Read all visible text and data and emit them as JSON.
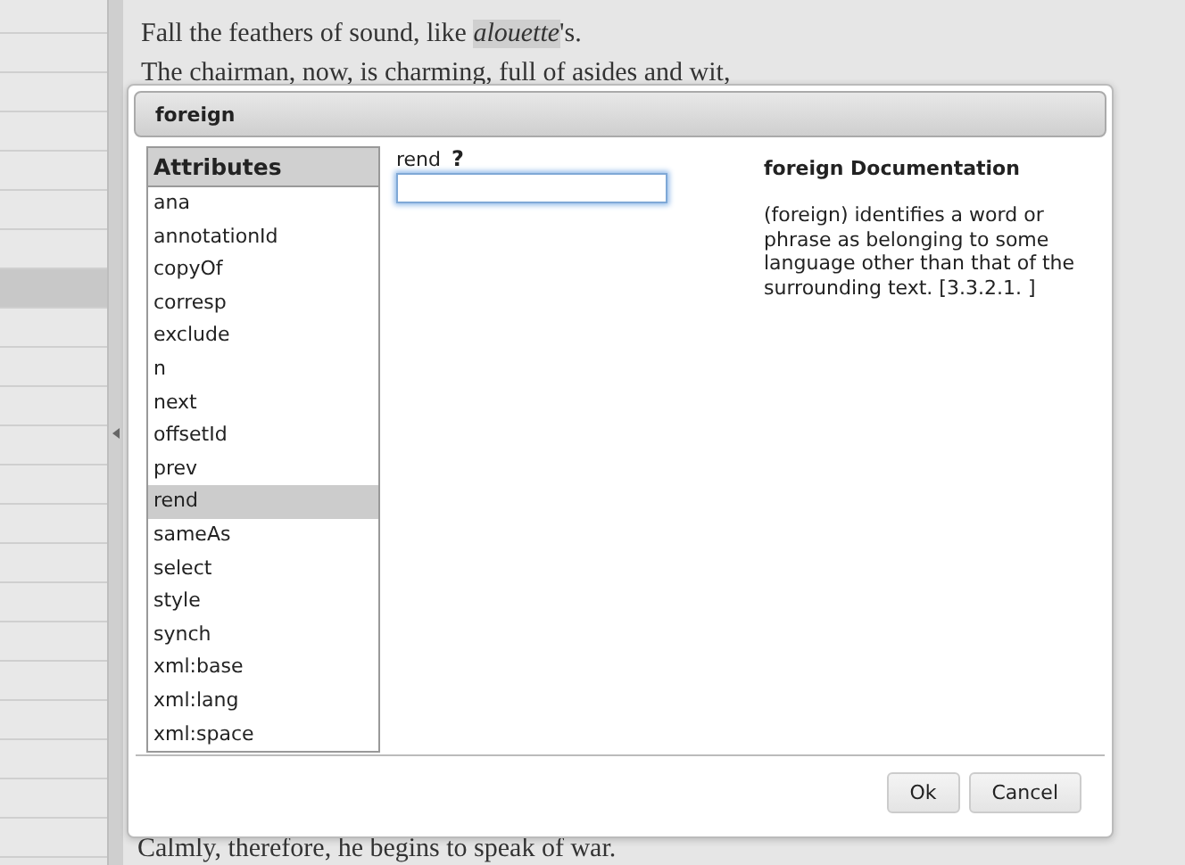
{
  "sidebar": {
    "rows": [
      {
        "selected": false
      },
      {
        "selected": false
      },
      {
        "selected": false
      },
      {
        "selected": false
      },
      {
        "selected": false
      },
      {
        "selected": false
      },
      {
        "selected": false
      },
      {
        "selected": true
      },
      {
        "selected": false
      },
      {
        "selected": false
      },
      {
        "selected": false
      },
      {
        "selected": false
      },
      {
        "selected": false
      },
      {
        "selected": false
      },
      {
        "selected": false
      },
      {
        "selected": false
      },
      {
        "selected": false
      },
      {
        "selected": false
      },
      {
        "selected": false
      },
      {
        "selected": false
      },
      {
        "selected": false
      },
      {
        "selected": false
      }
    ]
  },
  "document": {
    "lines": [
      "Fall the feathers of sound, like *alouette*'s.",
      "The chairman, now, is charming, full of asides and wit,"
    ],
    "bottom_line": "Calmly, therefore, he begins to speak of war."
  },
  "dialog": {
    "title": "foreign",
    "attributes": {
      "heading": "Attributes",
      "items": [
        {
          "label": "ana",
          "selected": false
        },
        {
          "label": "annotationId",
          "selected": false
        },
        {
          "label": "copyOf",
          "selected": false
        },
        {
          "label": "corresp",
          "selected": false
        },
        {
          "label": "exclude",
          "selected": false
        },
        {
          "label": "n",
          "selected": false
        },
        {
          "label": "next",
          "selected": false
        },
        {
          "label": "offsetId",
          "selected": false
        },
        {
          "label": "prev",
          "selected": false
        },
        {
          "label": "rend",
          "selected": true
        },
        {
          "label": "sameAs",
          "selected": false
        },
        {
          "label": "select",
          "selected": false
        },
        {
          "label": "style",
          "selected": false
        },
        {
          "label": "synch",
          "selected": false
        },
        {
          "label": "xml:base",
          "selected": false
        },
        {
          "label": "xml:lang",
          "selected": false
        },
        {
          "label": "xml:space",
          "selected": false
        }
      ]
    },
    "field": {
      "label": "rend",
      "help": "?",
      "focused": true
    },
    "documentation": {
      "title": "foreign Documentation",
      "text": "(foreign) identifies a word or phrase as belonging to some language other than that of the surrounding text. [3.3.2.1. ]"
    },
    "buttons": [
      "Ok",
      "Cancel"
    ]
  }
}
